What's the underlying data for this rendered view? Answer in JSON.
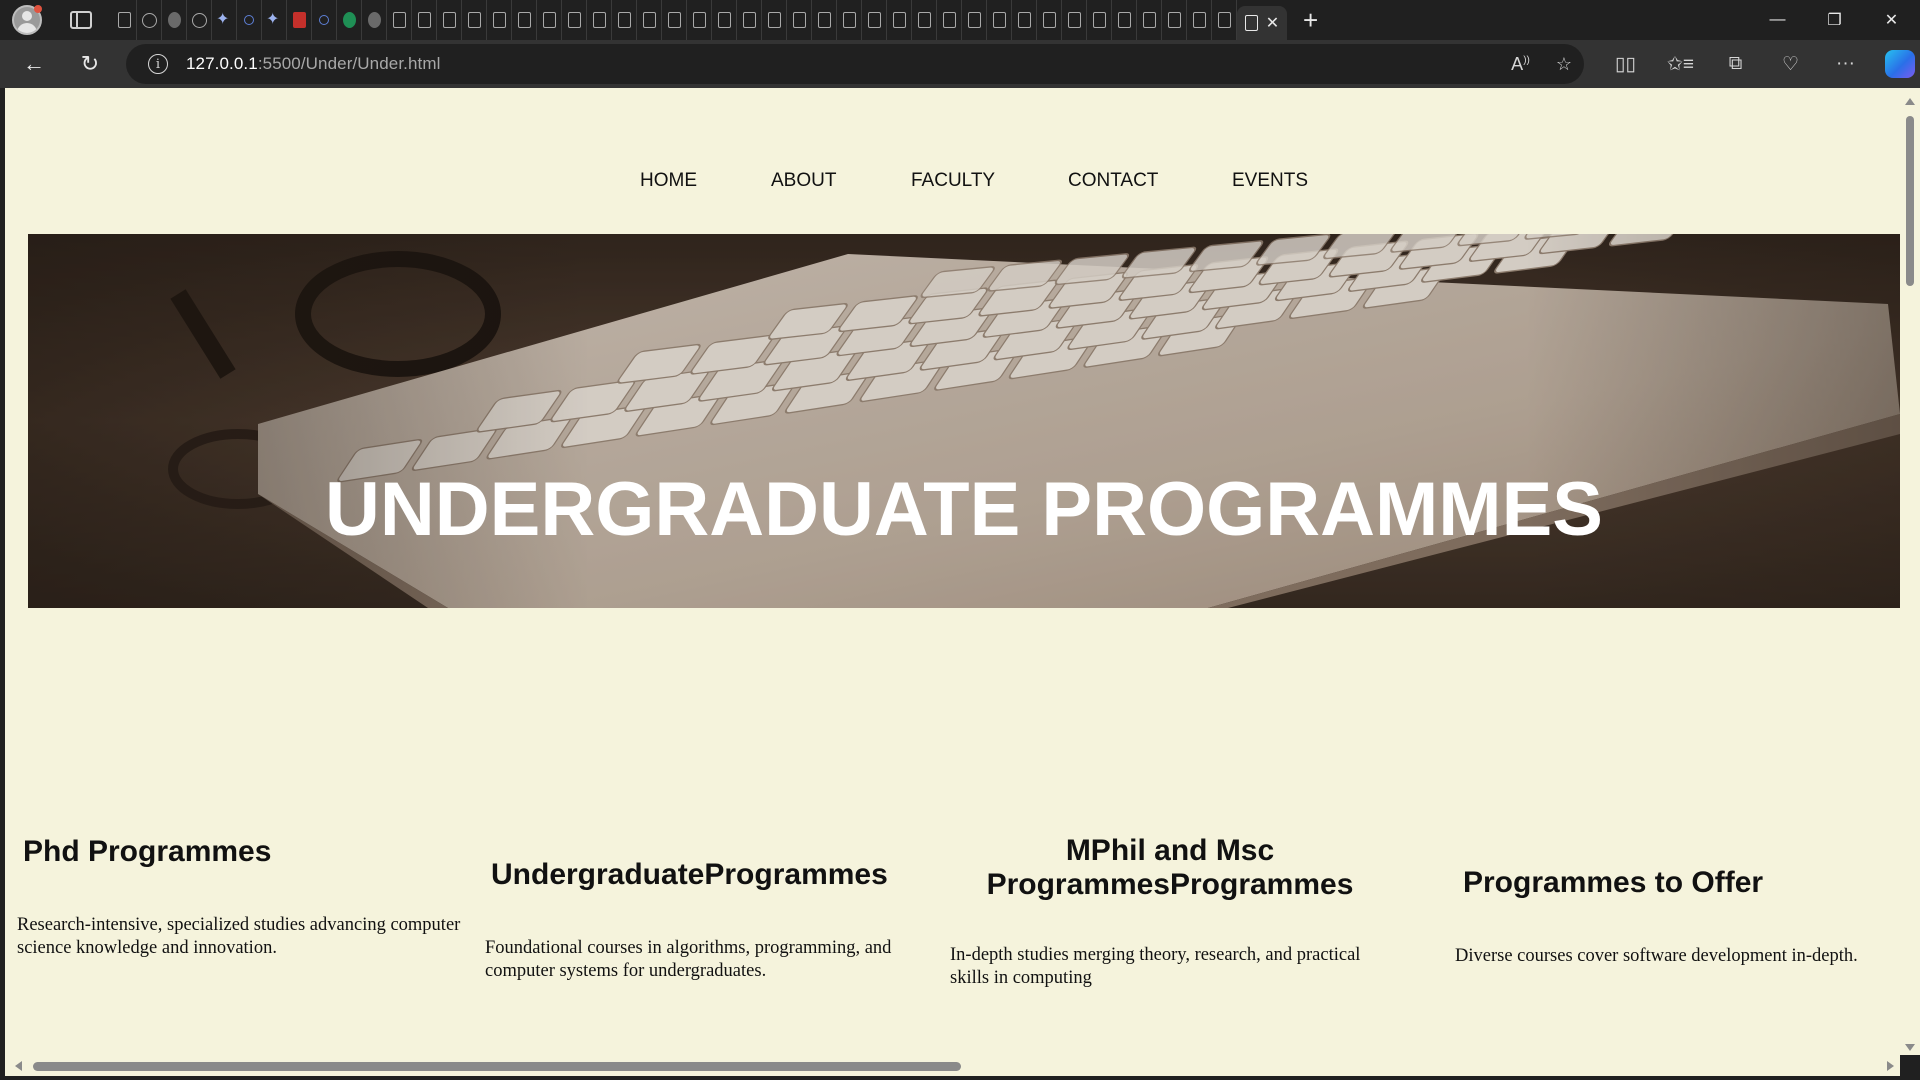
{
  "browser": {
    "url_host": "127.0.0.1",
    "url_path": ":5500/Under/Under.html",
    "tab_close": "✕",
    "new_tab": "+",
    "minimize": "—",
    "restore": "❐",
    "close": "✕"
  },
  "nav": {
    "home": "HOME",
    "about": "ABOUT",
    "faculty": "FACULTY",
    "contact": "CONTACT",
    "events": "EVENTS"
  },
  "hero": {
    "title": "UNDERGRADUATE PROGRAMMES"
  },
  "cards": [
    {
      "title": "Phd Programmes",
      "text": "Research-intensive, specialized studies advancing computer science knowledge and innovation."
    },
    {
      "title": "UndergraduateProgrammes",
      "text": "Foundational courses in algorithms, programming, and computer systems for undergraduates."
    },
    {
      "title": "MPhil and Msc ProgrammesProgrammes",
      "text": "In-depth studies merging theory, research, and practical skills in computing"
    },
    {
      "title": "Programmes to Offer",
      "text": "Diverse courses cover software development in-depth."
    }
  ],
  "colors": {
    "page_background": "#f5f3dc",
    "chrome_dark": "#202020",
    "toolbar": "#333333"
  }
}
